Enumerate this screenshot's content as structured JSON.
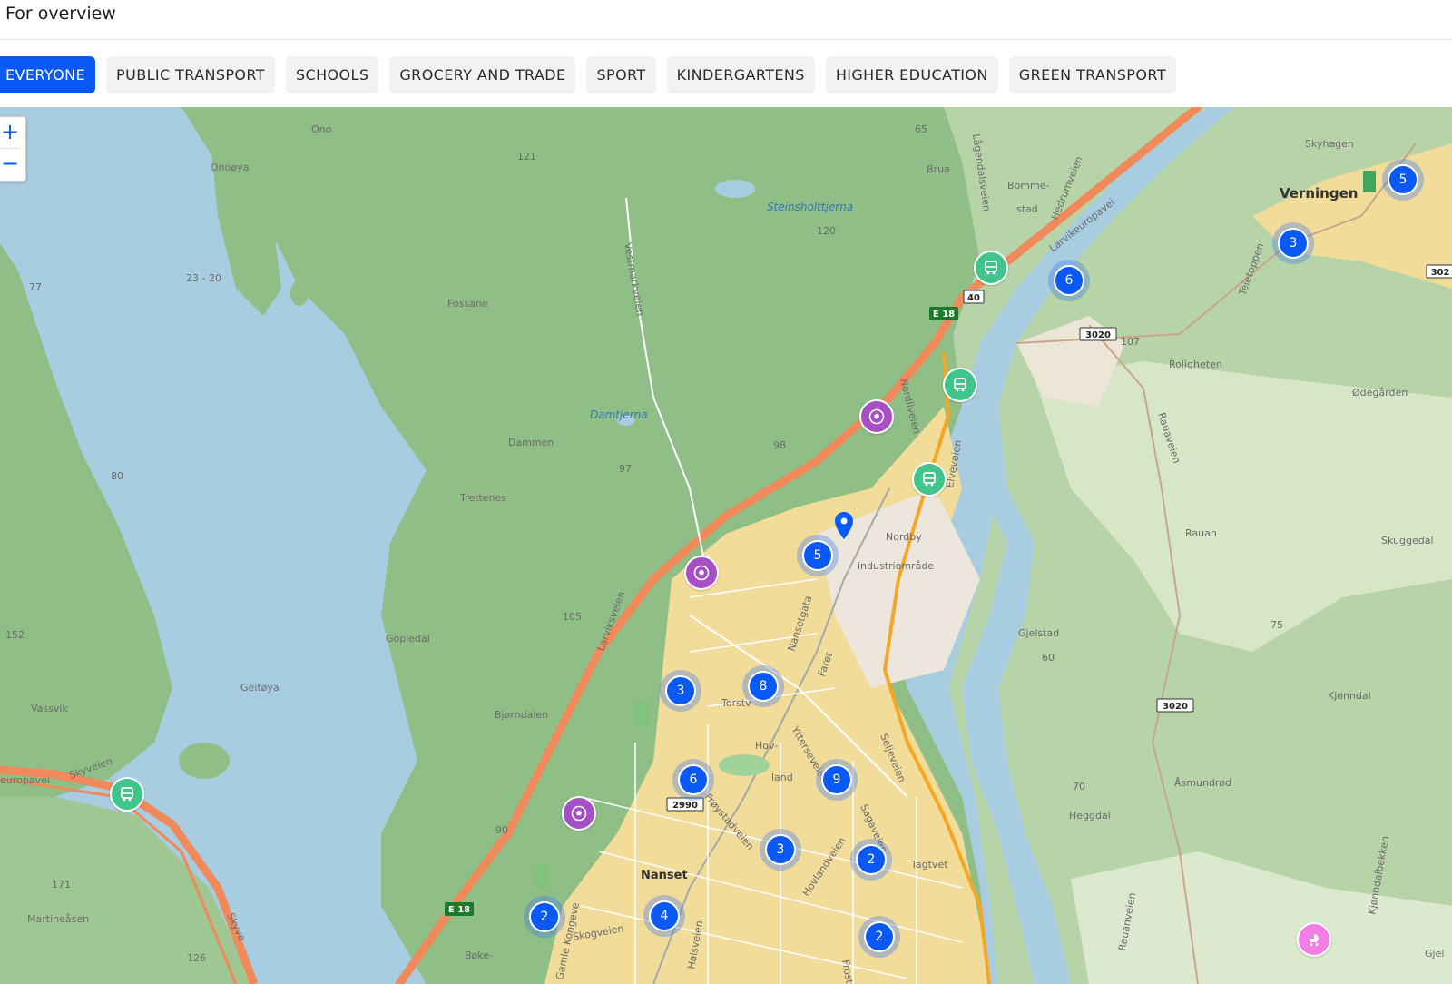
{
  "header": {
    "title": "For overview"
  },
  "filters": [
    {
      "label": "EVERYONE",
      "active": true
    },
    {
      "label": "PUBLIC TRANSPORT",
      "active": false
    },
    {
      "label": "SCHOOLS",
      "active": false
    },
    {
      "label": "GROCERY AND TRADE",
      "active": false
    },
    {
      "label": "SPORT",
      "active": false
    },
    {
      "label": "KINDERGARTENS",
      "active": false
    },
    {
      "label": "HIGHER EDUCATION",
      "active": false
    },
    {
      "label": "GREEN TRANSPORT",
      "active": false
    }
  ],
  "zoom": {
    "in_label": "+",
    "out_label": "−"
  },
  "colors": {
    "accent": "#0b59f5",
    "bus": "#3fc48b",
    "sport": "#a64fc6",
    "kindergarten": "#f17ee3",
    "water": "#a9cde0",
    "forest": "#8fbf86",
    "urban": "#f1dc9a",
    "motorway": "#f08a5a"
  },
  "clusters": [
    "5",
    "3",
    "6",
    "5",
    "3",
    "8",
    "6",
    "9",
    "3",
    "2",
    "2",
    "4",
    "2"
  ],
  "markers": {
    "bus_icon": "bus-icon",
    "sport_icon": "football-icon",
    "kindergarten_icon": "stroller-icon",
    "location_icon": "location-pin-icon"
  },
  "map_labels": {
    "places": [
      "Ono",
      "Onoøya",
      "Fossane",
      "Dammen",
      "Trettenes",
      "Gopledal",
      "Geitøya",
      "Vassvik",
      "Bjørndalen",
      "Martineåsen",
      "Bøke-",
      "Brua",
      "Bomme-",
      "stad",
      "Skyhagen",
      "Roligheten",
      "Ødegården",
      "Rauan",
      "Skuggedal",
      "Gjelstad",
      "Kjønndal",
      "Åsmundrød",
      "Heggdal",
      "Gjel",
      "Nordby",
      "industriområde",
      "Hov-",
      "land"
    ],
    "water": [
      "Steinsholttjerna",
      "Damtjerna"
    ],
    "towns": [
      "Verningen",
      "Nanset"
    ],
    "roads": [
      "Vestmarkveien",
      "Larviksveien",
      "Lågendalsveien",
      "Hedrumveien",
      "Larvikeuropavei",
      "Nordliveien",
      "Nansetgata",
      "Elveveien",
      "Faret",
      "Torstv",
      "Ytterseveien",
      "Frøystadveien",
      "Seljeveien",
      "Sagaveien",
      "Hovlandveien",
      "Skogveien",
      "Gamle Kongeve",
      "Kjønndalbekken",
      "Rauanveien",
      "Teietoppen",
      "Rauaveien",
      "Skyveien",
      "europavei",
      "Skyve",
      "Tagtvet",
      "Halsveien",
      "Frost"
    ],
    "road_numbers": [
      "E 18",
      "E 18",
      "40",
      "3020",
      "3020",
      "2990",
      "302"
    ],
    "elevations": [
      "65",
      "121",
      "120",
      "77",
      "23 - 20",
      "80",
      "97",
      "98",
      "105",
      "152",
      "90",
      "171",
      "126",
      "107",
      "75",
      "60",
      "70"
    ]
  }
}
